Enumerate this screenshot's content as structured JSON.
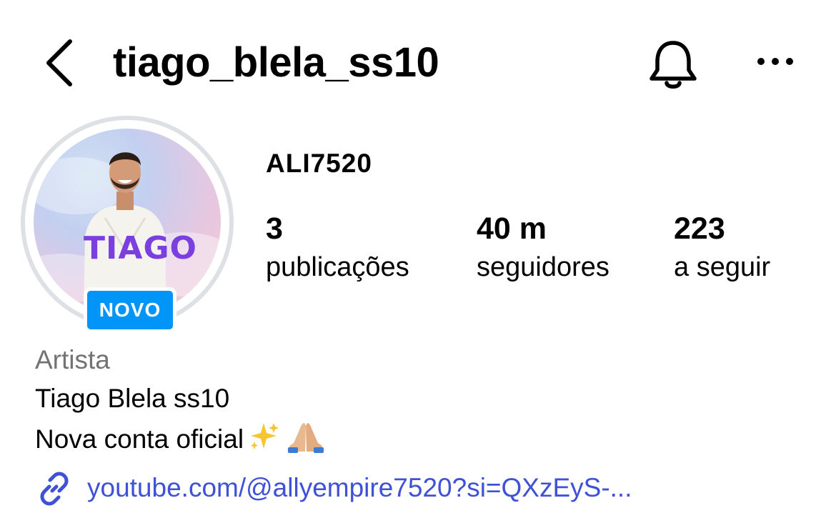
{
  "header": {
    "back_icon": "chevron-left-icon",
    "username": "tiago_blela_ss10",
    "notifications_icon": "bell-icon",
    "more_icon": "ellipsis-icon"
  },
  "profile": {
    "avatar_text": "TIAGO",
    "badge": "NOVO",
    "display_name": "ALI7520",
    "stats": [
      {
        "value": "3",
        "label": "publicações"
      },
      {
        "value": "40 m",
        "label": "seguidores"
      },
      {
        "value": "223",
        "label": "a seguir"
      }
    ],
    "category": "Artista",
    "bio": [
      "Tiago Blela ss10",
      "Nova conta oficial"
    ],
    "bio_emoji": [
      "sparkles-emoji",
      "folded-hands-emoji"
    ],
    "link_icon": "link-icon",
    "link": "youtube.com/@allyempire7520?si=QXzEyS-..."
  },
  "colors": {
    "badge": "#0095f6",
    "link": "#3f51d6",
    "category": "#737373",
    "avatar_ring": "#dde1e6"
  }
}
